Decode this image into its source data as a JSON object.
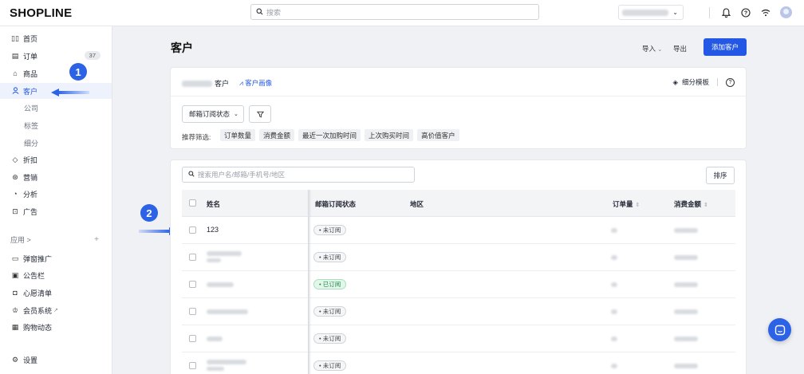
{
  "topbar": {
    "logo": "SHOPLINE",
    "search_placeholder": "搜索"
  },
  "sidebar": {
    "items": [
      {
        "label": "首页",
        "icon": "home-icon"
      },
      {
        "label": "订单",
        "icon": "order-icon",
        "badge": "37"
      },
      {
        "label": "商品",
        "icon": "bag-icon"
      },
      {
        "label": "客户",
        "icon": "user-icon"
      },
      {
        "label": "公司"
      },
      {
        "label": "标签"
      },
      {
        "label": "细分"
      },
      {
        "label": "折扣",
        "icon": "tag-icon"
      },
      {
        "label": "营销",
        "icon": "marketing-icon"
      },
      {
        "label": "分析",
        "icon": "analytics-icon"
      },
      {
        "label": "广告",
        "icon": "ads-icon"
      }
    ],
    "apps_label": "应用 >",
    "apps_add": "+",
    "apps": [
      {
        "label": "弹窗推广",
        "icon": "popup-icon"
      },
      {
        "label": "公告栏",
        "icon": "announcement-icon"
      },
      {
        "label": "心愿清单",
        "icon": "wishlist-icon"
      },
      {
        "label": "会员系统",
        "icon": "membership-icon"
      },
      {
        "label": "购物动态",
        "icon": "activity-icon"
      }
    ],
    "settings_label": "设置"
  },
  "annotations": {
    "step1": "1",
    "step2": "2"
  },
  "main": {
    "title": "客户",
    "import_label": "导入",
    "export_label": "导出",
    "add_label": "添加客户"
  },
  "segment": {
    "suffix": "客户",
    "image_label": "客户画像",
    "template_label": "细分模板",
    "help": "?",
    "filter_select": "邮箱订阅状态",
    "rec_label": "推荐筛选:",
    "chips": [
      "订单数量",
      "消费金额",
      "最近一次加购时间",
      "上次购买时间",
      "高价值客户"
    ]
  },
  "table": {
    "search_placeholder": "搜索用户名/邮箱/手机号/地区",
    "sort_label": "排序",
    "headers": {
      "name": "姓名",
      "email_status": "邮箱订阅状态",
      "region": "地区",
      "orders": "订单量",
      "spent": "消费金额"
    },
    "rows": [
      {
        "name": "123",
        "status": "• 未订阅",
        "subscribed": false
      },
      {
        "name": "",
        "status": "• 未订阅",
        "subscribed": false
      },
      {
        "name": "",
        "status": "• 已订阅",
        "subscribed": true
      },
      {
        "name": "",
        "status": "• 未订阅",
        "subscribed": false
      },
      {
        "name": "",
        "status": "• 未订阅",
        "subscribed": false
      },
      {
        "name": "",
        "status": "• 未订阅",
        "subscribed": false
      }
    ]
  },
  "colors": {
    "accent": "#2358e6",
    "subscribed_bg": "#e3f6ea",
    "subscribed_text": "#1f8a4c"
  }
}
